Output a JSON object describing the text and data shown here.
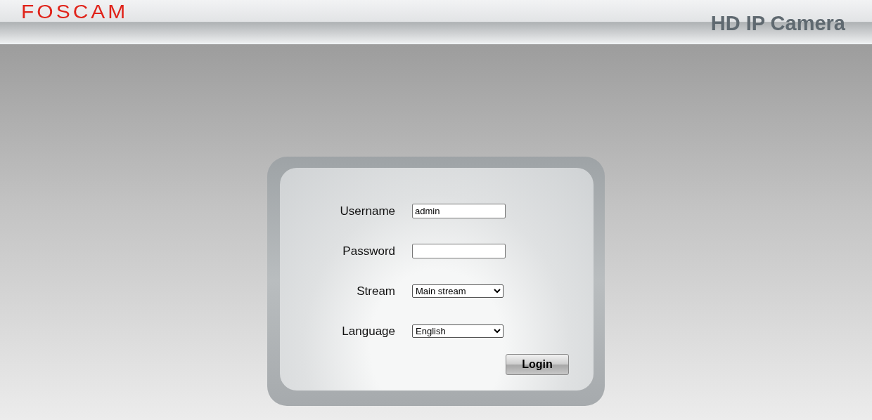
{
  "header": {
    "logo": "FOSCAM",
    "product": "HD IP Camera"
  },
  "login_form": {
    "fields": [
      {
        "kind": "input",
        "label": "Username",
        "value": "admin"
      },
      {
        "kind": "password",
        "label": "Password"
      },
      {
        "kind": "select",
        "label": "Stream",
        "value": "Main stream"
      },
      {
        "kind": "select",
        "label": "Language",
        "value": "English"
      }
    ],
    "submit": "Login"
  }
}
